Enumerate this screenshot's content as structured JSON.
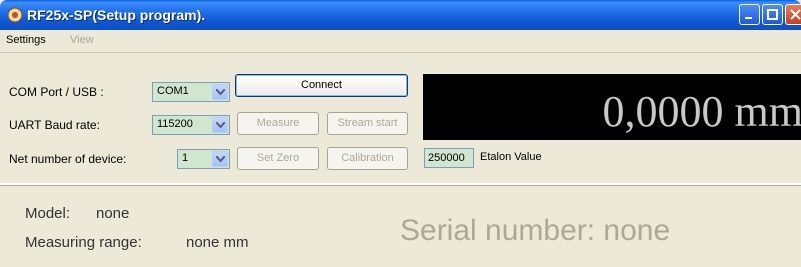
{
  "window": {
    "title": "RF25x-SP(Setup program)."
  },
  "menu": {
    "settings": "Settings",
    "view": "View"
  },
  "com": {
    "label": "COM Port / USB :",
    "value": "COM1",
    "connect": "Connect"
  },
  "uart": {
    "label": "UART Baud rate:",
    "value": "115200",
    "measure": "Measure",
    "stream": "Stream start"
  },
  "net": {
    "label": "Net number of device:",
    "value": "1",
    "setzero": "Set Zero",
    "calibration": "Calibration"
  },
  "display": {
    "value": "0,0000 mm"
  },
  "etalon": {
    "value": "250000",
    "label": "Etalon Value"
  },
  "info": {
    "model_label": "Model:",
    "model_value": "none",
    "range_label": "Measuring range:",
    "range_value": "none mm",
    "serial": "Serial number:  none"
  }
}
